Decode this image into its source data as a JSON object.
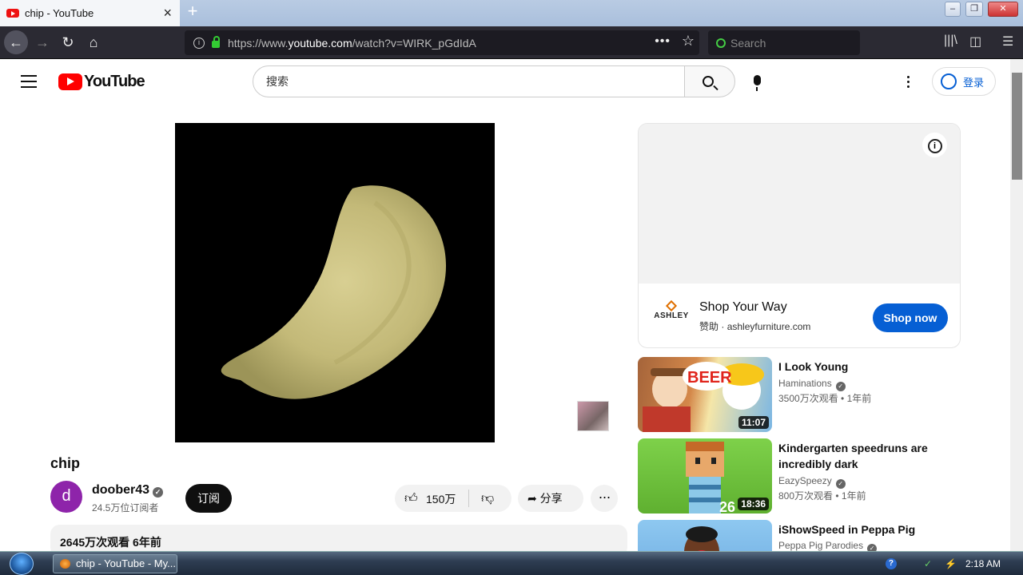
{
  "browser": {
    "tab_title": "chip - YouTube",
    "url_prefix": "https://www.",
    "url_domain": "youtube.com",
    "url_path": "/watch?v=WIRK_pGdIdA",
    "search_placeholder": "Search"
  },
  "youtube": {
    "logo_text": "YouTube",
    "search_value": "搜索",
    "signin_label": "登录"
  },
  "video": {
    "title": "chip",
    "channel_initial": "d",
    "channel_name": "doober43",
    "subscribers": "24.5万位订阅者",
    "subscribe_label": "订阅",
    "like_count": "150万",
    "share_label": "分享",
    "description_meta": "2645万次观看  6年前"
  },
  "ad": {
    "brand": "ASHLEY",
    "headline": "Shop Your Way",
    "sponsor_label": "赞助",
    "domain": "ashleyfurniture.com",
    "cta": "Shop now"
  },
  "recommendations": [
    {
      "title": "I Look Young",
      "channel": "Haminations",
      "views": "3500万次观看",
      "age": "1年前",
      "duration": "11:07",
      "thumb_text": "BEER"
    },
    {
      "title": "Kindergarten speedruns are incredibly dark",
      "channel": "EazySpeezy",
      "views": "800万次观看",
      "age": "1年前",
      "duration": "18:36",
      "thumb_text": "26"
    },
    {
      "title": "iShowSpeed in Peppa Pig",
      "channel": "Peppa Pig Parodies",
      "views": "",
      "age": "",
      "duration": "",
      "thumb_text": ""
    }
  ],
  "taskbar": {
    "task_label": "chip - YouTube - My...",
    "clock": "2:18 AM"
  }
}
